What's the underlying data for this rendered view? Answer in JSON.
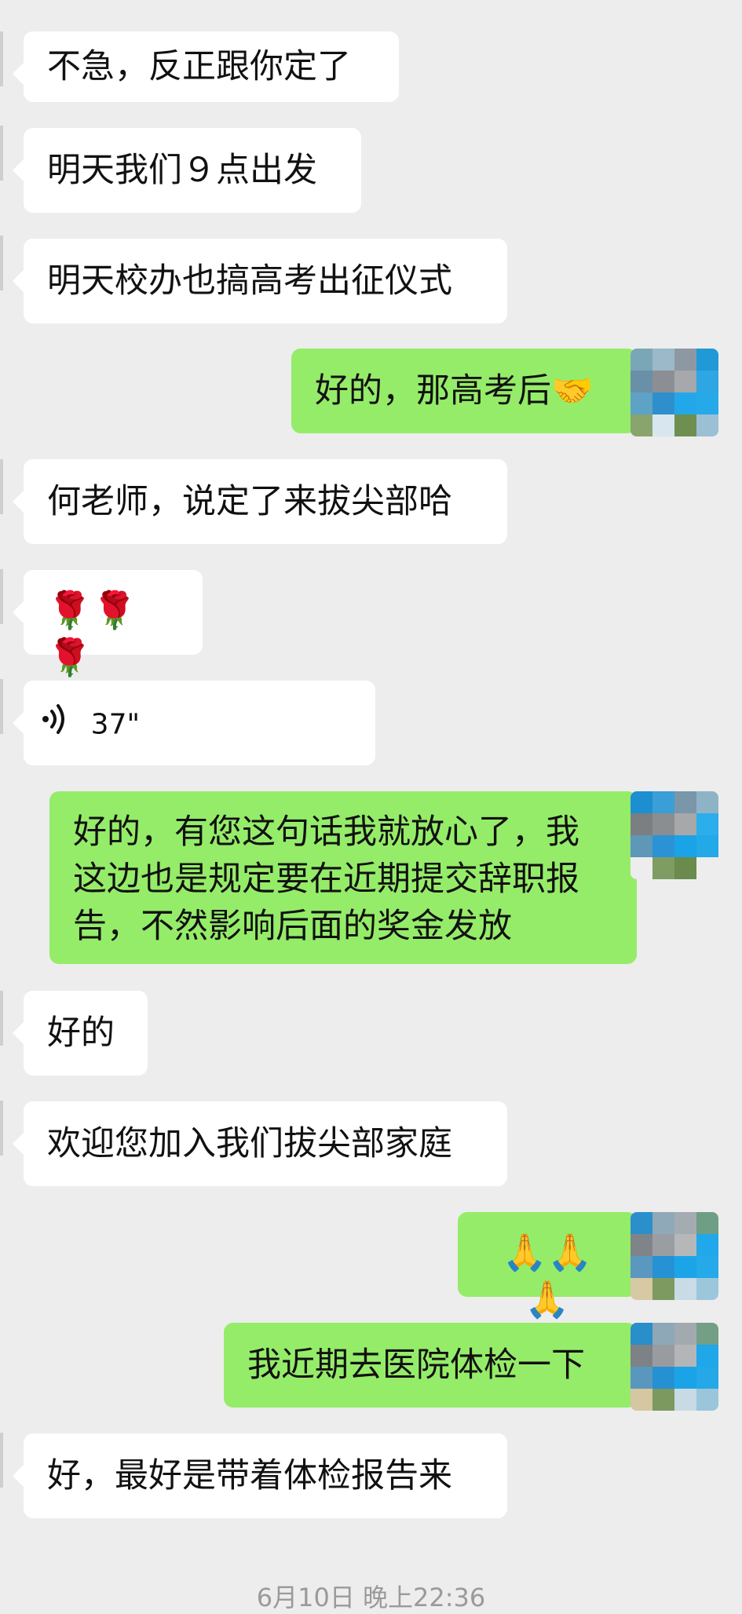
{
  "messages": [
    {
      "side": "in",
      "text": "不急，反正跟你定了"
    },
    {
      "side": "in",
      "text": "明天我们９点出发"
    },
    {
      "side": "in",
      "text": "明天校办也搞高考出征仪式"
    },
    {
      "side": "out",
      "text": "好的，那高考后🤝"
    },
    {
      "side": "in",
      "text": "何老师，说定了来拔尖部哈"
    },
    {
      "side": "in",
      "text": "🌹🌹🌹"
    },
    {
      "side": "in",
      "voice": true,
      "duration": "37\""
    },
    {
      "side": "out",
      "lines": [
        "好的，有您这句话我就放心了，我",
        "这边也是规定要在近期提交辞职报",
        "告，不然影响后面的奖金发放"
      ]
    },
    {
      "side": "in",
      "text": "好的"
    },
    {
      "side": "in",
      "text": "欢迎您加入我们拔尖部家庭"
    },
    {
      "side": "out",
      "text": "🙏🙏🙏"
    },
    {
      "side": "out",
      "text": "我近期去医院体检一下"
    },
    {
      "side": "in",
      "text": "好，最好是带着体检报告来"
    }
  ],
  "timestamp": "6月10日 晚上22:36",
  "colors": {
    "background": "#ededed",
    "incoming": "#ffffff",
    "outgoing": "#95ec69"
  },
  "icons": {
    "voice": "voice-wave-icon",
    "avatar": "pixelated-avatar"
  }
}
